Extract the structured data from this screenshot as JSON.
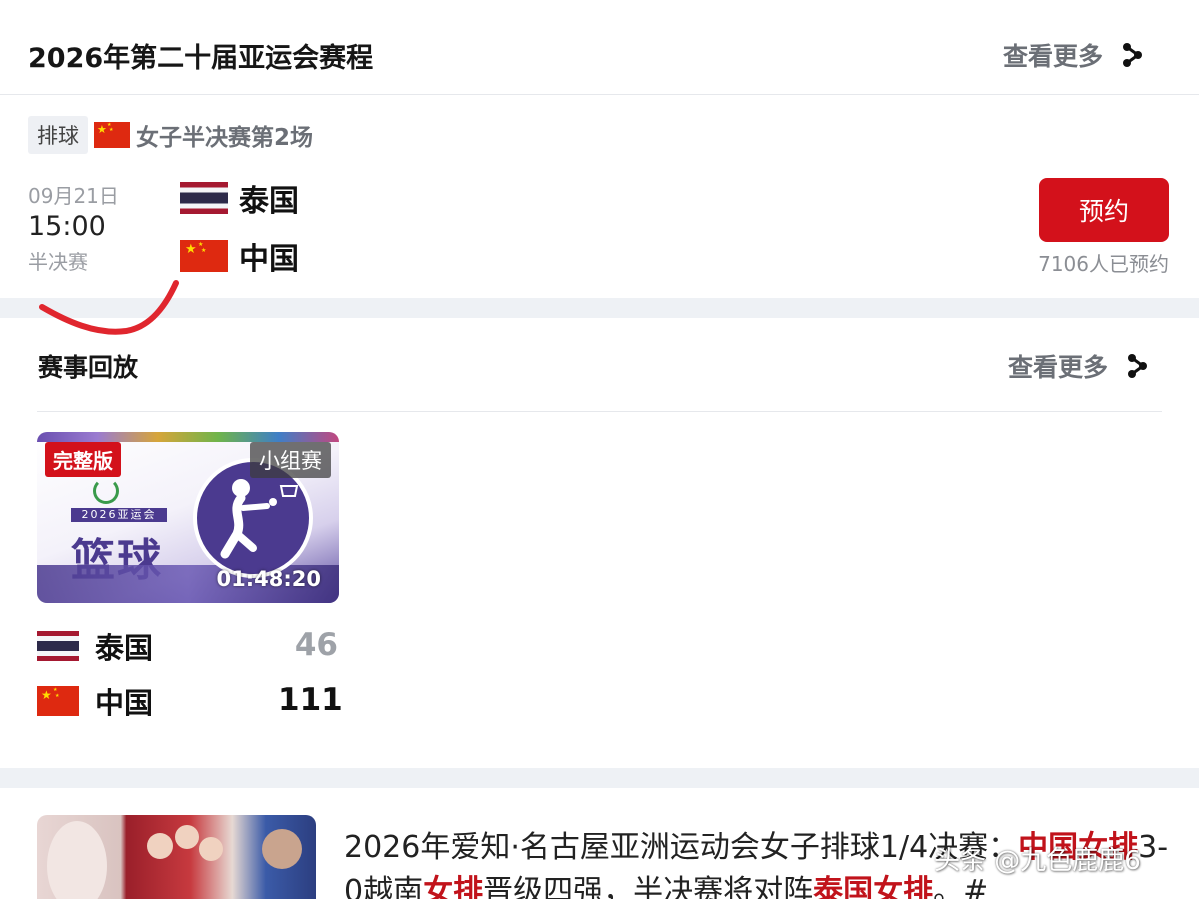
{
  "schedule": {
    "title": "2026年第二十届亚运会赛程",
    "more_label": "查看更多",
    "match": {
      "sport_tag": "排球",
      "round": "女子半决赛第2场",
      "date": "09月21日",
      "time": "15:00",
      "stage": "半决赛",
      "team1": {
        "name": "泰国",
        "flag": "thailand-flag"
      },
      "team2": {
        "name": "中国",
        "flag": "china-flag"
      },
      "reserve_label": "预约",
      "reserve_count": "7106人已预约"
    }
  },
  "replay": {
    "title": "赛事回放",
    "more_label": "查看更多",
    "video": {
      "badge_full": "完整版",
      "badge_group": "小组赛",
      "event_line": "2026亚运会",
      "sport_name": "篮球",
      "duration": "01:48:20",
      "icon": "basketball-player-icon"
    },
    "team1": {
      "name": "泰国",
      "score": "46",
      "flag": "thailand-flag"
    },
    "team2": {
      "name": "中国",
      "score": "111",
      "flag": "china-flag"
    }
  },
  "news": {
    "parts": [
      {
        "text": "2026年爱知·名古屋亚洲运动会女子排球1/4决赛：",
        "hl": false
      },
      {
        "text": "中国女排",
        "hl": true
      },
      {
        "text": "3-0越南",
        "hl": false
      },
      {
        "text": "女排",
        "hl": true
      },
      {
        "text": "晋级四强，半决赛将对阵",
        "hl": false
      },
      {
        "text": "泰国女排",
        "hl": true
      },
      {
        "text": "。#",
        "hl": false
      }
    ]
  },
  "watermark": "头条 @九色鹿鹿6",
  "colors": {
    "accent_red": "#d3111b",
    "highlight_red": "#c1131b",
    "muted_gray": "#6b6f76",
    "section_gap": "#eef1f5",
    "annotation_red": "#e0262e"
  }
}
